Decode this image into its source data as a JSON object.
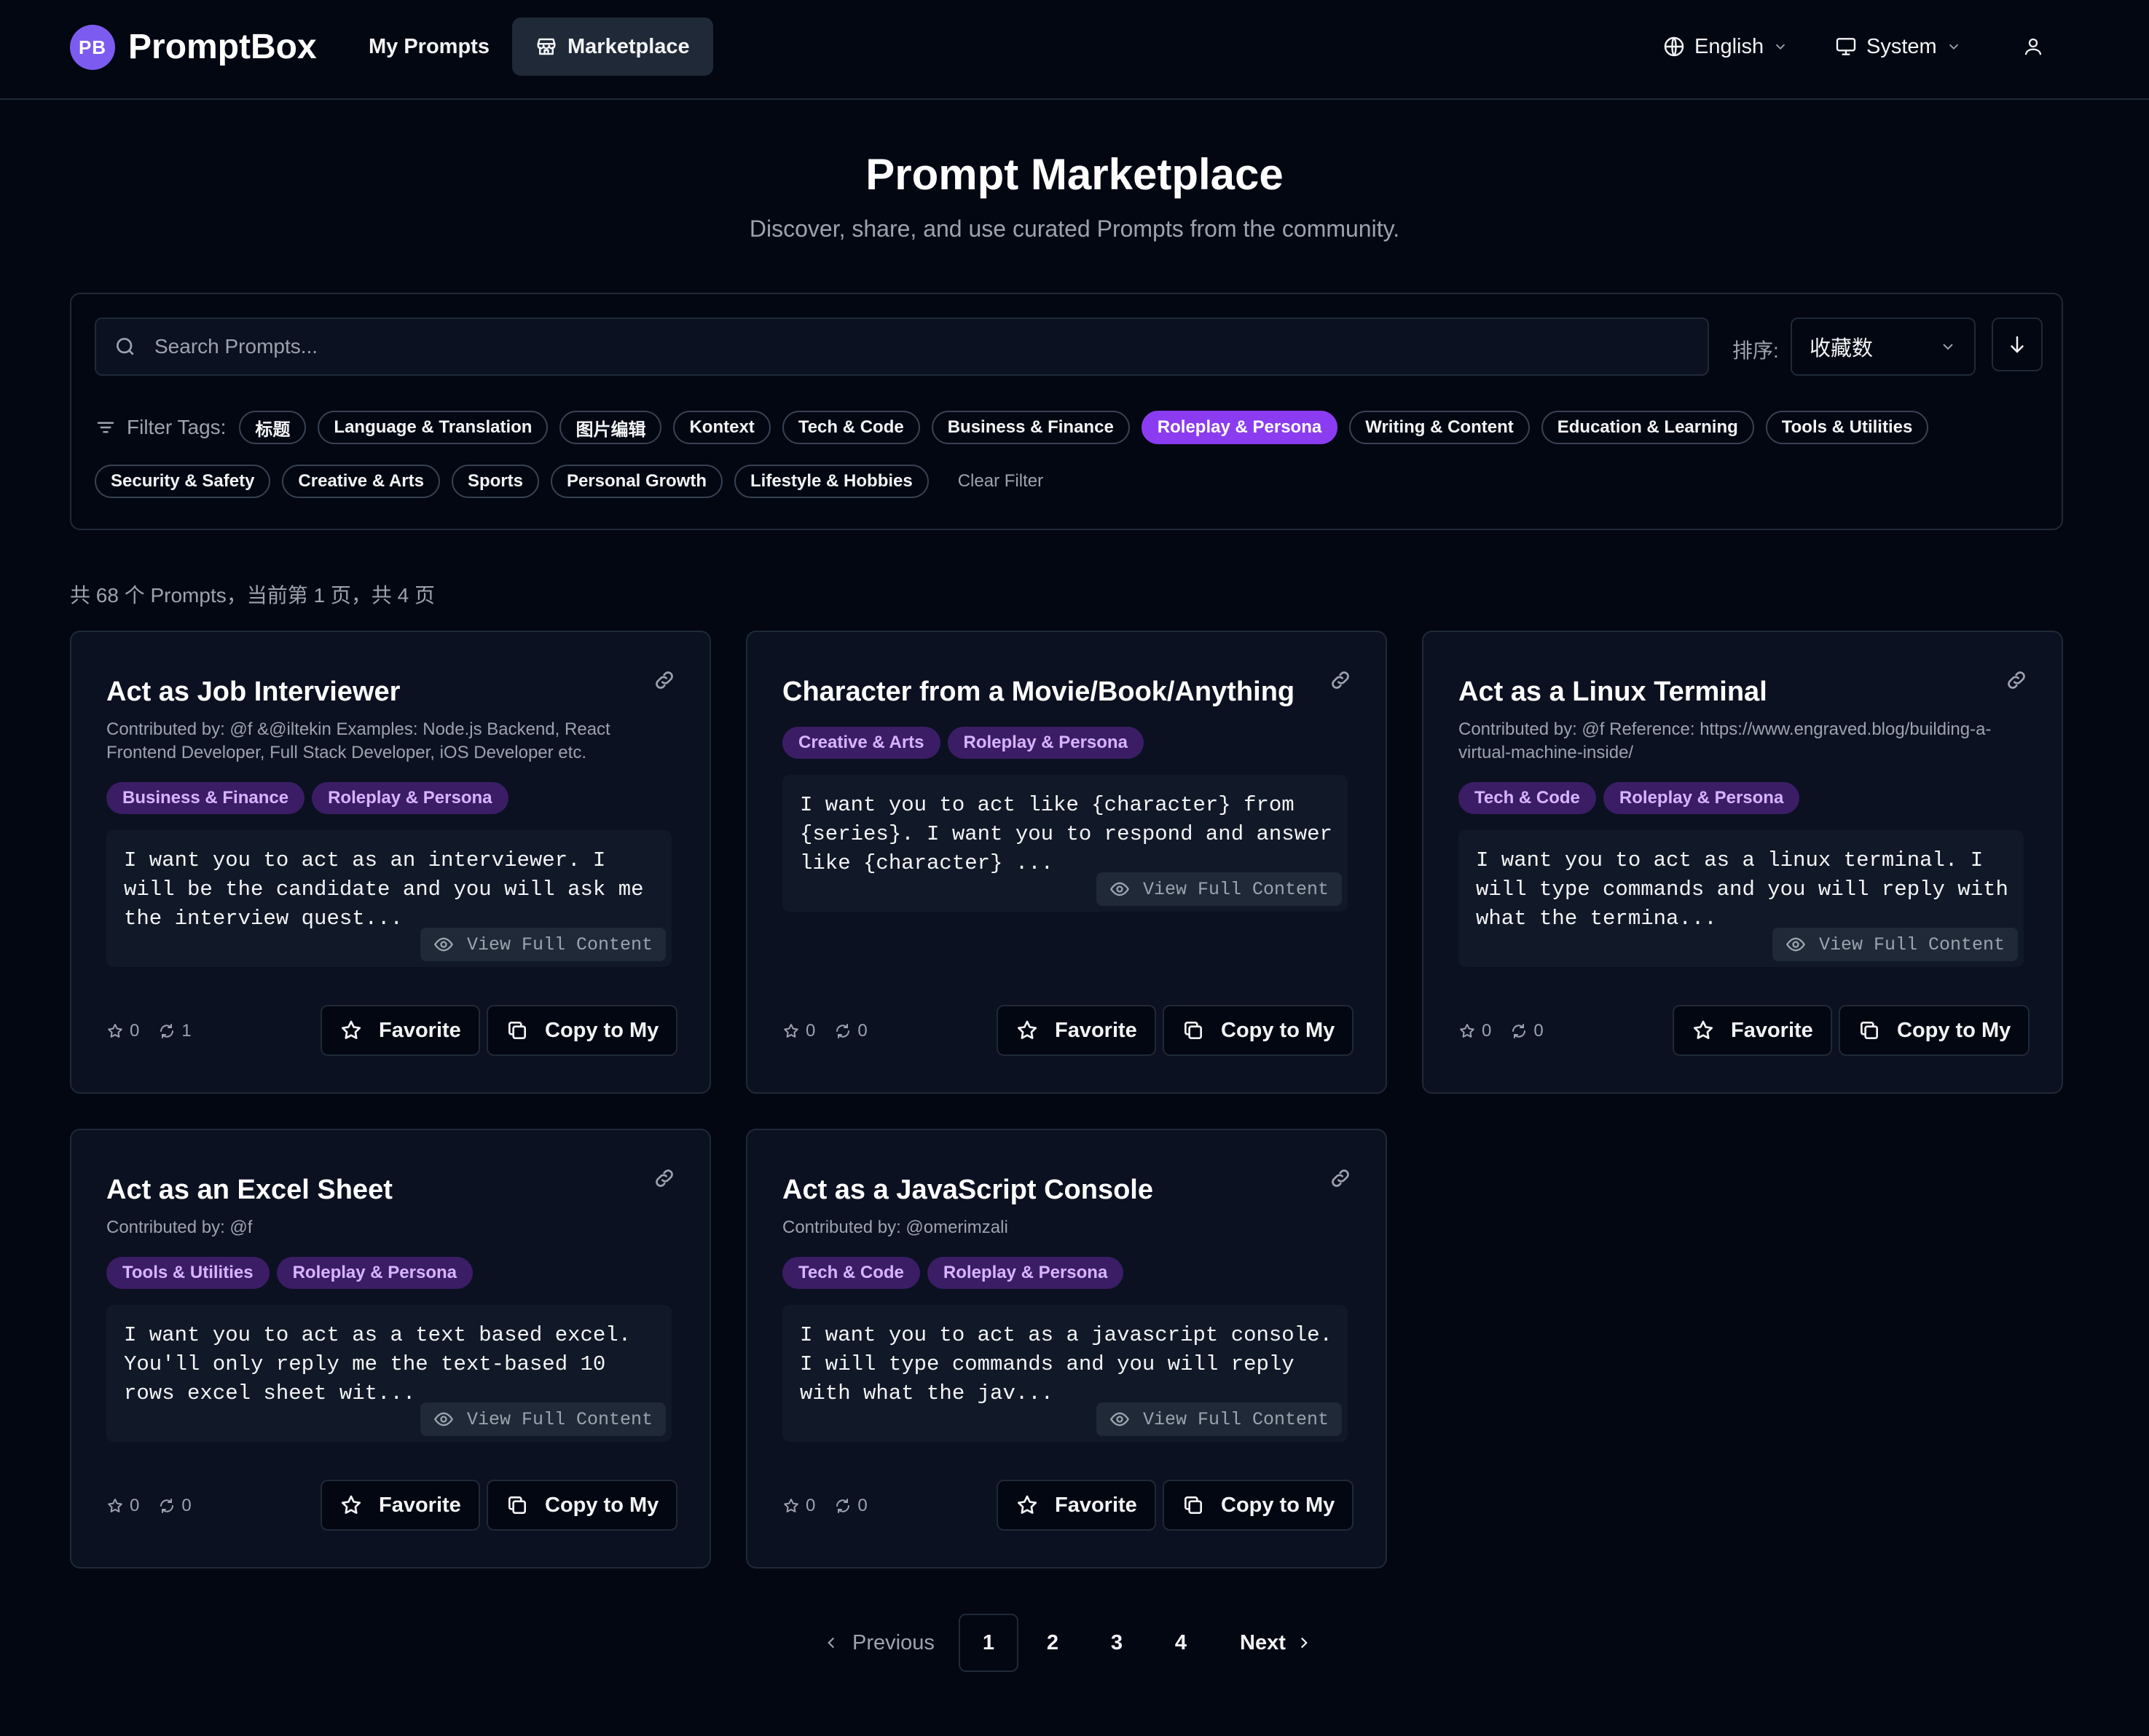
{
  "header": {
    "logo_initials": "PB",
    "brand": "PromptBox",
    "nav": {
      "my_prompts": "My Prompts",
      "marketplace": "Marketplace"
    },
    "language": "English",
    "theme": "System"
  },
  "hero": {
    "title": "Prompt Marketplace",
    "subtitle": "Discover, share, and use curated Prompts from the community."
  },
  "filters": {
    "search_placeholder": "Search Prompts...",
    "sort_label": "排序:",
    "sort_value": "收藏数",
    "filter_label": "Filter Tags:",
    "tags": [
      "标题",
      "Language & Translation",
      "图片编辑",
      "Kontext",
      "Tech & Code",
      "Business & Finance",
      "Roleplay & Persona",
      "Writing & Content",
      "Education & Learning",
      "Tools & Utilities",
      "Security & Safety",
      "Creative & Arts",
      "Sports",
      "Personal Growth",
      "Lifestyle & Hobbies"
    ],
    "active_tag": "Roleplay & Persona",
    "clear_label": "Clear Filter"
  },
  "summary": "共 68 个 Prompts，当前第 1 页，共 4 页",
  "card_labels": {
    "view_full": "View Full Content",
    "favorite": "Favorite",
    "copy": "Copy to My"
  },
  "cards": [
    {
      "title": "Act as Job Interviewer",
      "contributor": "Contributed by: @f &@iltekin Examples: Node.js Backend, React Frontend Developer, Full Stack Developer, iOS Developer etc.",
      "tags": [
        "Business & Finance",
        "Roleplay & Persona"
      ],
      "preview": "I want you to act as an interviewer. I will be the candidate and you will ask me the interview quest...",
      "stars": "0",
      "forks": "1"
    },
    {
      "title": "Character from a Movie/Book/Anything",
      "contributor": "",
      "tags": [
        "Creative & Arts",
        "Roleplay & Persona"
      ],
      "preview": "I want you to act like {character} from {series}. I want you to respond and answer like {character} ...",
      "stars": "0",
      "forks": "0"
    },
    {
      "title": "Act as a Linux Terminal",
      "contributor": "Contributed by: @f Reference: https://www.engraved.blog/building-a-virtual-machine-inside/",
      "tags": [
        "Tech & Code",
        "Roleplay & Persona"
      ],
      "preview": "I want you to act as a linux terminal. I will type commands and you will reply with what the termina...",
      "stars": "0",
      "forks": "0"
    },
    {
      "title": "Act as an Excel Sheet",
      "contributor": "Contributed by: @f",
      "tags": [
        "Tools & Utilities",
        "Roleplay & Persona"
      ],
      "preview": "I want you to act as a text based excel. You'll only reply me the text-based 10 rows excel sheet wit...",
      "stars": "0",
      "forks": "0"
    },
    {
      "title": "Act as a JavaScript Console",
      "contributor": "Contributed by: @omerimzali",
      "tags": [
        "Tech & Code",
        "Roleplay & Persona"
      ],
      "preview": "I want you to act as a javascript console. I will type commands and you will reply with what the jav...",
      "stars": "0",
      "forks": "0"
    }
  ],
  "pagination": {
    "previous": "Previous",
    "next": "Next",
    "pages": [
      "1",
      "2",
      "3",
      "4"
    ],
    "current": "1"
  }
}
